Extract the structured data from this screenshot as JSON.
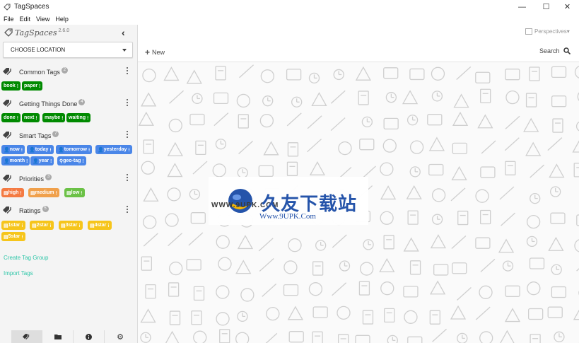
{
  "window": {
    "title": "TagSpaces",
    "minimize": "—",
    "maximize": "☐",
    "close": "✕"
  },
  "menu": [
    "File",
    "Edit",
    "View",
    "Help"
  ],
  "brand": {
    "name": "TagSpaces",
    "version": "2.6.0"
  },
  "location": {
    "label": "CHOOSE LOCATION"
  },
  "groups": [
    {
      "name": "Common Tags",
      "count": "2",
      "tags": [
        "book",
        "paper"
      ]
    },
    {
      "name": "Getting Things Done",
      "count": "4",
      "tags": [
        "done",
        "next",
        "maybe",
        "waiting"
      ]
    },
    {
      "name": "Smart Tags",
      "count": "7",
      "tags": [
        "now",
        "today",
        "tomorrow",
        "yesterday",
        "month",
        "year",
        "geo-tag"
      ]
    },
    {
      "name": "Priorities",
      "count": "3",
      "tags": [
        "high",
        "medium",
        "low"
      ]
    },
    {
      "name": "Ratings",
      "count": "5",
      "tags": [
        "1star",
        "2star",
        "3star",
        "4star",
        "5star"
      ]
    }
  ],
  "links": {
    "create": "Create Tag Group",
    "import": "Import Tags"
  },
  "toolbar": {
    "perspectives": "Perspectives",
    "new": "New",
    "search": "Search"
  },
  "watermark": {
    "site": "WWW.9UPK.COM",
    "cn": "久友下载站",
    "url": "Www.9UPK.Com"
  },
  "colors": {
    "green": "#008a00",
    "blue": "#4a86e8",
    "orange": "#f47a42",
    "yellow": "#f6c51b",
    "lime": "#6bc146",
    "link": "#2ec6a8"
  }
}
